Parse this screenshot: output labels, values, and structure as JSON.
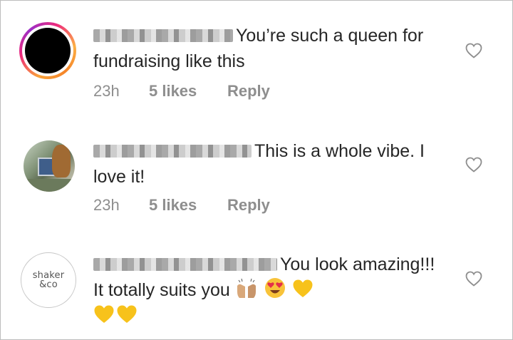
{
  "comments": [
    {
      "text": "You’re such a queen for fundraising like this",
      "time": "23h",
      "likes": "5 likes",
      "reply": "Reply"
    },
    {
      "text": "This is a whole vibe. I love it!",
      "time": "23h",
      "likes": "5 likes",
      "reply": "Reply"
    },
    {
      "text": "You look amazing!!! It totally suits you",
      "time": "",
      "likes": "",
      "reply": "",
      "logo_line1": "shaker",
      "logo_line2": "&co",
      "emojis": [
        "raising-hands-emoji",
        "heart-eyes-emoji",
        "yellow-heart-emoji",
        "yellow-heart-emoji",
        "yellow-heart-emoji"
      ]
    }
  ],
  "colors": {
    "text": "#262626",
    "meta": "#8e8e8e",
    "heart": "#8e8e8e",
    "ring_start": "#f58529",
    "ring_end": "#ee2a7b",
    "yellow_heart": "#f7c21b"
  }
}
